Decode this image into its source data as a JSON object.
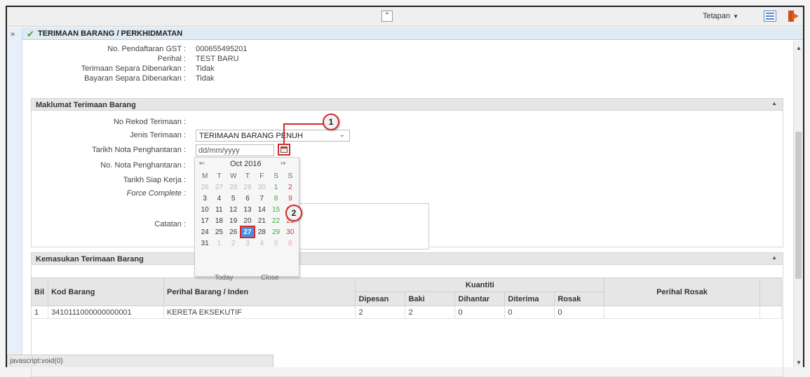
{
  "topbar": {
    "collapse_icon": "double-chevron-up-icon",
    "settings_label": "Tetapan",
    "list_icon": "list-view-icon",
    "logout_icon": "logout-icon"
  },
  "title": {
    "expand_icon": "double-chevron-right-icon",
    "check_icon": "check-icon",
    "text": "TERIMAAN BARANG / PERKHIDMATAN"
  },
  "info": [
    {
      "label": "No. Pendaftaran GST :",
      "value": "000655495201"
    },
    {
      "label": "Perihal :",
      "value": "TEST BARU"
    },
    {
      "label": "Terimaan Separa Dibenarkan :",
      "value": "Tidak"
    },
    {
      "label": "Bayaran Separa Dibenarkan :",
      "value": "Tidak"
    }
  ],
  "section1": {
    "title": "Maklumat Terimaan Barang"
  },
  "form": {
    "no_rekod_label": "No Rekod Terimaan :",
    "jenis_label": "Jenis Terimaan :",
    "jenis_value": "TERIMAAN BARANG PENUH",
    "tarikh_nota_label": "Tarikh Nota Penghantaran :",
    "tarikh_nota_placeholder": "dd/mm/yyyy",
    "no_nota_label": "No. Nota Penghantaran :",
    "tarikh_siap_label": "Tarikh Siap Kerja :",
    "force_label": "Force Complete :",
    "catatan_label": "Catatan :"
  },
  "callouts": [
    "1",
    "2"
  ],
  "calendar": {
    "nav_prev": "« ‹",
    "nav_next": "› »",
    "month": "Oct 2016",
    "dow": [
      "M",
      "T",
      "W",
      "T",
      "F",
      "S",
      "S"
    ],
    "weeks": [
      [
        "26",
        "27",
        "28",
        "29",
        "30",
        "1",
        "2"
      ],
      [
        "3",
        "4",
        "5",
        "6",
        "7",
        "8",
        "9"
      ],
      [
        "10",
        "11",
        "12",
        "13",
        "14",
        "15",
        "16"
      ],
      [
        "17",
        "18",
        "19",
        "20",
        "21",
        "22",
        "23"
      ],
      [
        "24",
        "25",
        "26",
        "27",
        "28",
        "29",
        "30"
      ],
      [
        "31",
        "1",
        "2",
        "3",
        "4",
        "5",
        "6"
      ]
    ],
    "selected": "27",
    "today_label": "Today",
    "close_label": "Close"
  },
  "section2": {
    "title": "Kemasukan Terimaan Barang"
  },
  "table": {
    "headers": {
      "bil": "Bil",
      "kod": "Kod Barang",
      "perihal": "Perihal Barang / Inden",
      "kuantiti": "Kuantiti",
      "dipesan": "Dipesan",
      "baki": "Baki",
      "dihantar": "Dihantar",
      "diterima": "Diterima",
      "rosak": "Rosak",
      "perihal_rosak": "Perihal Rosak"
    },
    "rows": [
      {
        "bil": "1",
        "kod": "3410111000000000001",
        "perihal": "KERETA EKSEKUTIF",
        "dipesan": "2",
        "baki": "2",
        "dihantar": "0",
        "diterima": "0",
        "rosak": "0",
        "perihal_rosak": ""
      }
    ]
  },
  "status_text": "javascript:void(0)"
}
